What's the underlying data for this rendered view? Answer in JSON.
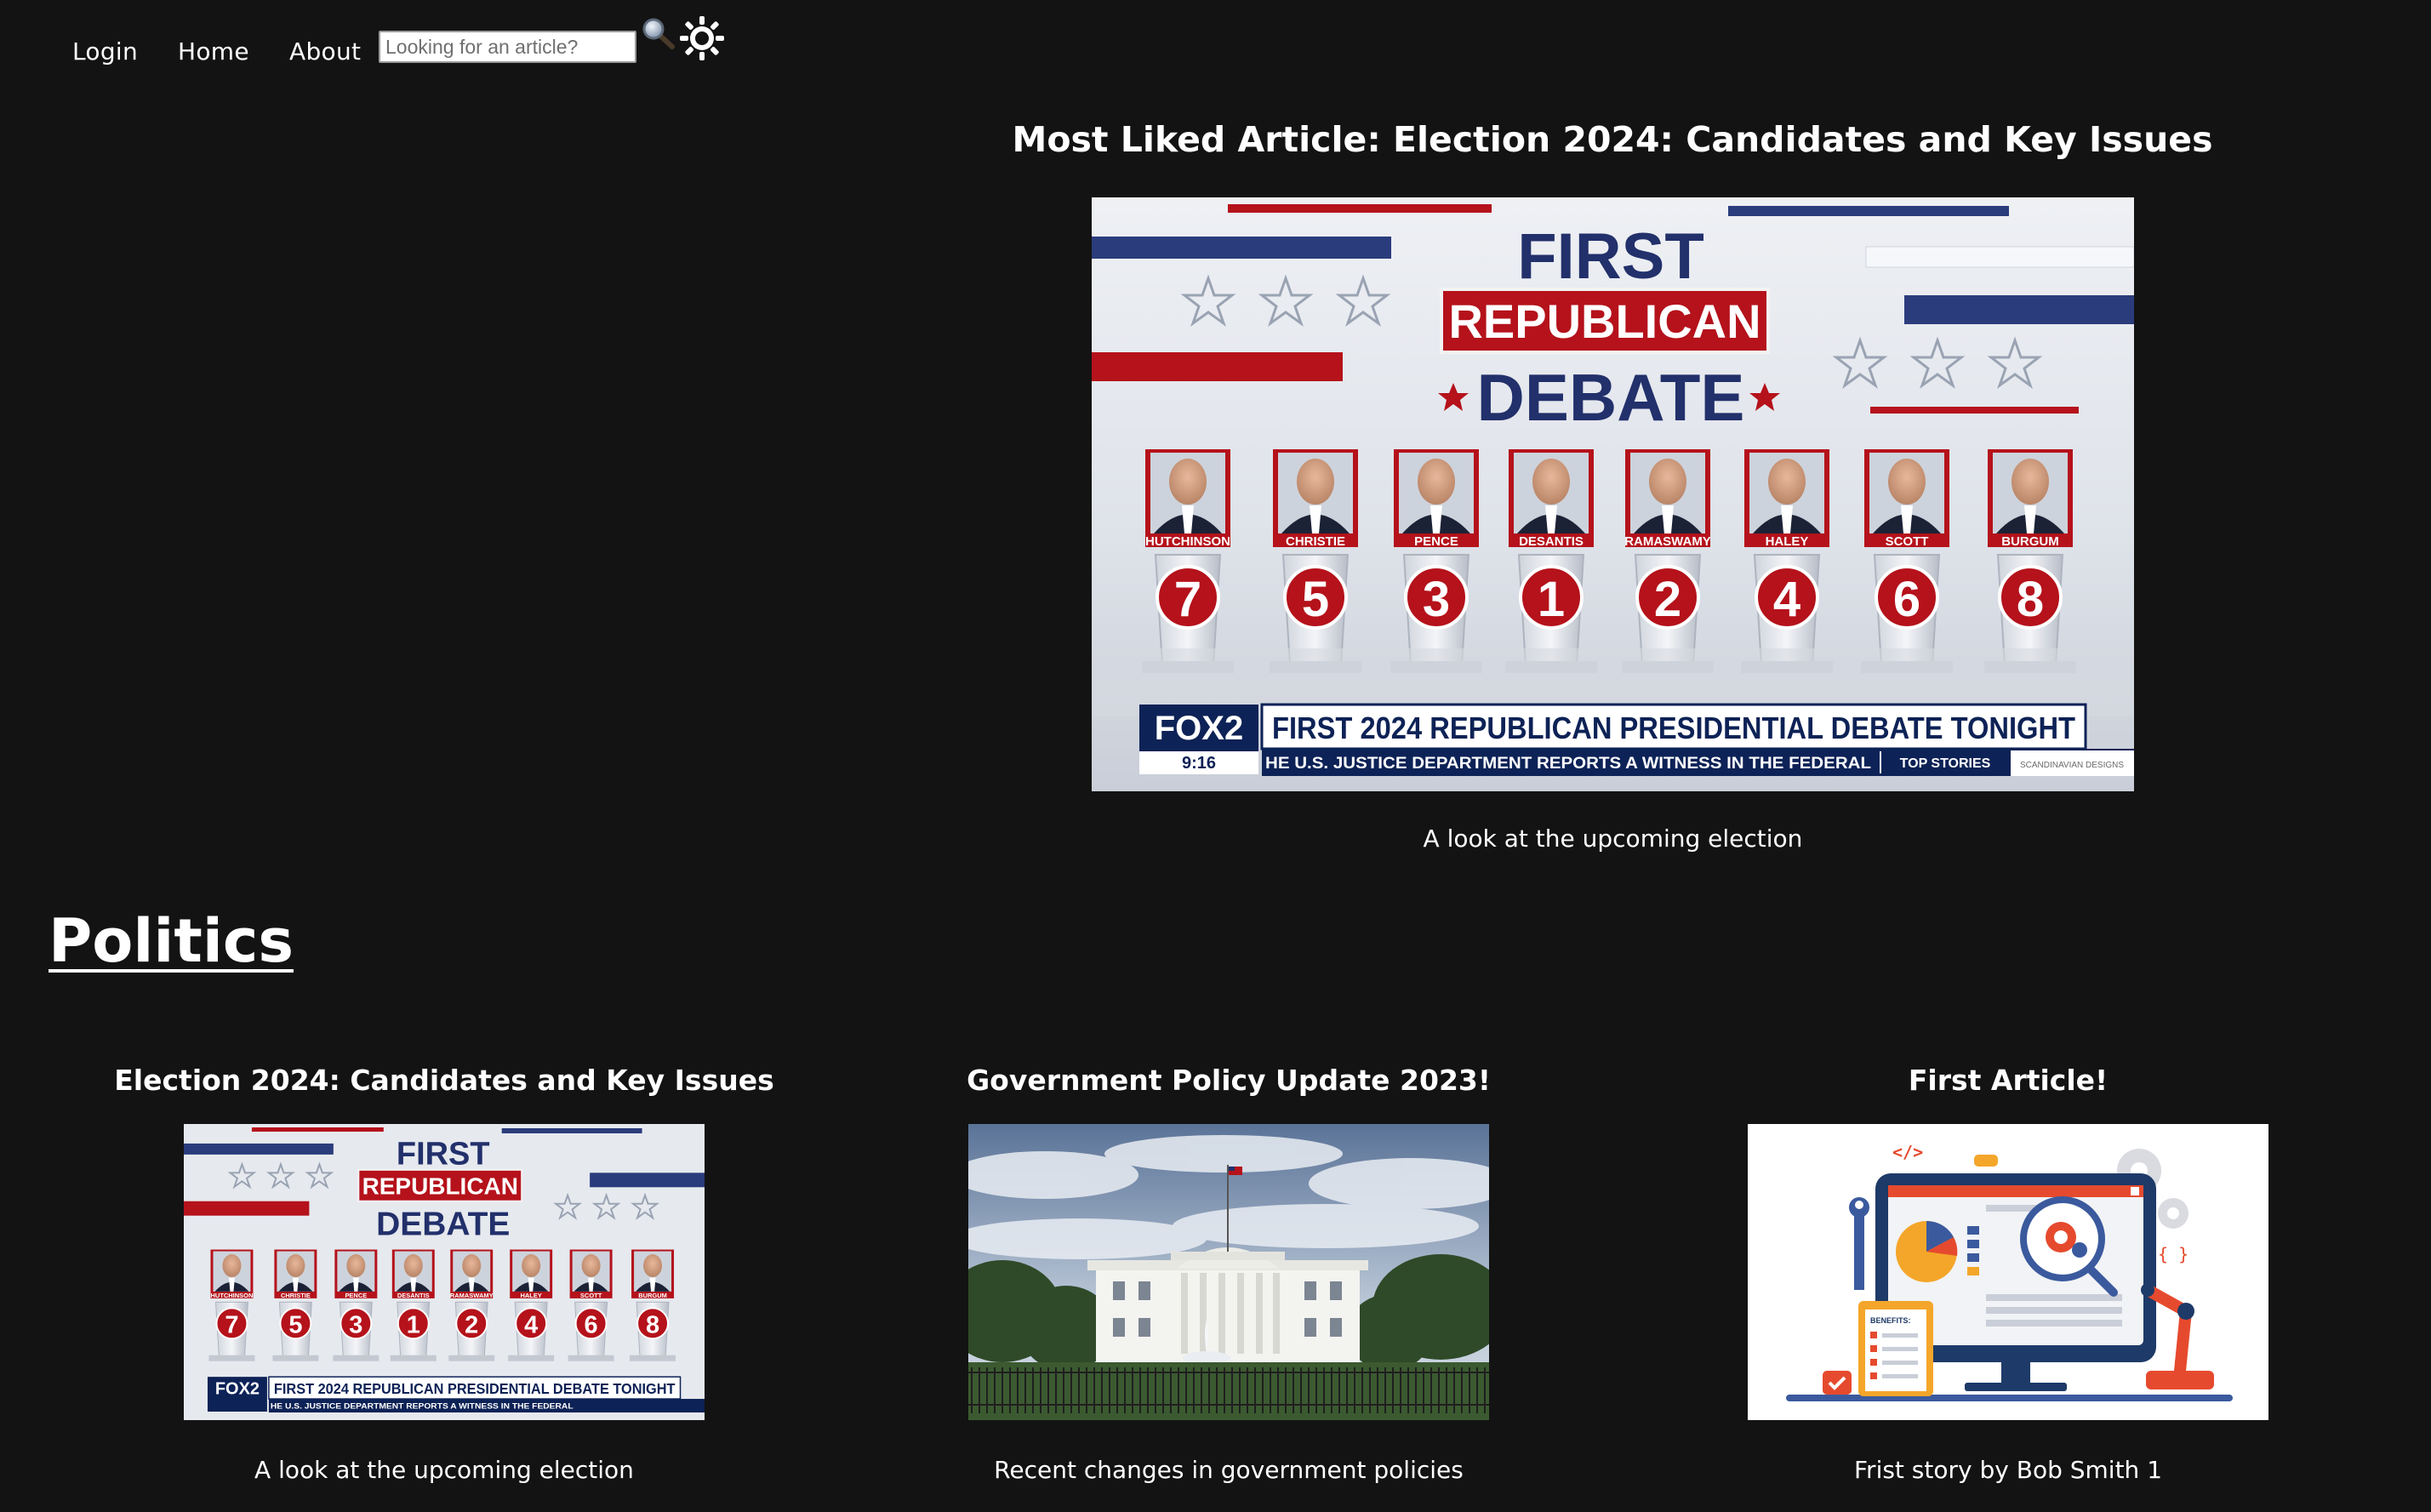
{
  "nav": {
    "login_label": "Login",
    "home_label": "Home",
    "about_label": "About",
    "search_placeholder": "Looking for an article?",
    "search_icon": "magnifier-icon",
    "theme_icon": "sun-icon"
  },
  "featured": {
    "title": "Most Liked Article: Election 2024: Candidates and Key Issues",
    "caption": "A look at the upcoming election",
    "image": {
      "heading_line1": "FIRST",
      "heading_line2": "REPUBLICAN",
      "heading_line3": "DEBATE",
      "candidates": [
        {
          "name": "HUTCHINSON",
          "number": "7"
        },
        {
          "name": "CHRISTIE",
          "number": "5"
        },
        {
          "name": "PENCE",
          "number": "3"
        },
        {
          "name": "DESANTIS",
          "number": "1"
        },
        {
          "name": "RAMASWAMY",
          "number": "2"
        },
        {
          "name": "HALEY",
          "number": "4"
        },
        {
          "name": "SCOTT",
          "number": "6"
        },
        {
          "name": "BURGUM",
          "number": "8"
        }
      ],
      "network": "FOX2",
      "time": "9:16",
      "headline": "FIRST 2024 REPUBLICAN PRESIDENTIAL DEBATE TONIGHT",
      "ticker": "HE U.S. JUSTICE DEPARTMENT REPORTS A WITNESS IN THE FEDERAL",
      "ticker_tag": "TOP STORIES",
      "sponsor": "SCANDINAVIAN DESIGNS"
    }
  },
  "section": {
    "heading": "Politics",
    "articles": [
      {
        "title": "Election 2024: Candidates and Key Issues",
        "caption": "A look at the upcoming election",
        "image": "debate-image"
      },
      {
        "title": "Government Policy Update 2023!",
        "caption": "Recent changes in government policies",
        "image": "white-house-image"
      },
      {
        "title": "First Article!",
        "caption": "Frist story by Bob Smith 1",
        "image": "developer-illustration-image",
        "illustration": {
          "code_tag": "</>",
          "benefits_label": "BENEFITS:",
          "braces": "{ }"
        }
      }
    ]
  },
  "colors": {
    "background": "#131313",
    "text": "#ffffff",
    "debate_red": "#b5121b",
    "debate_navy": "#22306b",
    "fox_navy": "#0d2256"
  }
}
